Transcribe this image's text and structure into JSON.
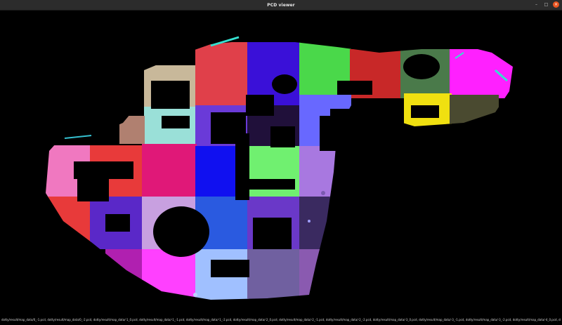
{
  "window": {
    "title": "PCD viewer"
  },
  "controls": {
    "minimize_icon": "–",
    "maximize_icon": "□",
    "close_icon": "×"
  },
  "status": {
    "files_text": "dotty/result/map_data/0_-1.pcd, dotty/result/map_data/0_-2.pcd, dotty/result/map_data/-1_0.pcd, dotty/result/map_data/-1_-1.pcd, dotty/result/map_data/-1_-2.pcd, dotty/result/map_data/-2_0.pcd, dotty/result/map_data/-2_-1.pcd, dotty/result/map_data/-2_-2.pcd, dotty/result/map_data/-3_0.pcd, dotty/result/map_data/-3_-1.pcd, dotty/result/map_data/-3_-2.pcd, dotty/result/map_data/-4_0.pcd, dotty/result/map_data/-4_-1.pcd"
  },
  "pointcloud": {
    "tile_colors": [
      "#c8b89a",
      "#e0404a",
      "#3a10d8",
      "#4ad84a",
      "#c82828",
      "#4a7a4a",
      "#ff20ff",
      "#9ae0d8",
      "#e01878",
      "#1010f0",
      "#70f070",
      "#6868ff",
      "#f0e010",
      "#4a4a30",
      "#f078c0",
      "#e83a3a",
      "#2a5ae0",
      "#a878e0",
      "#ff40ff",
      "#a0c0ff",
      "#7060a0"
    ]
  }
}
